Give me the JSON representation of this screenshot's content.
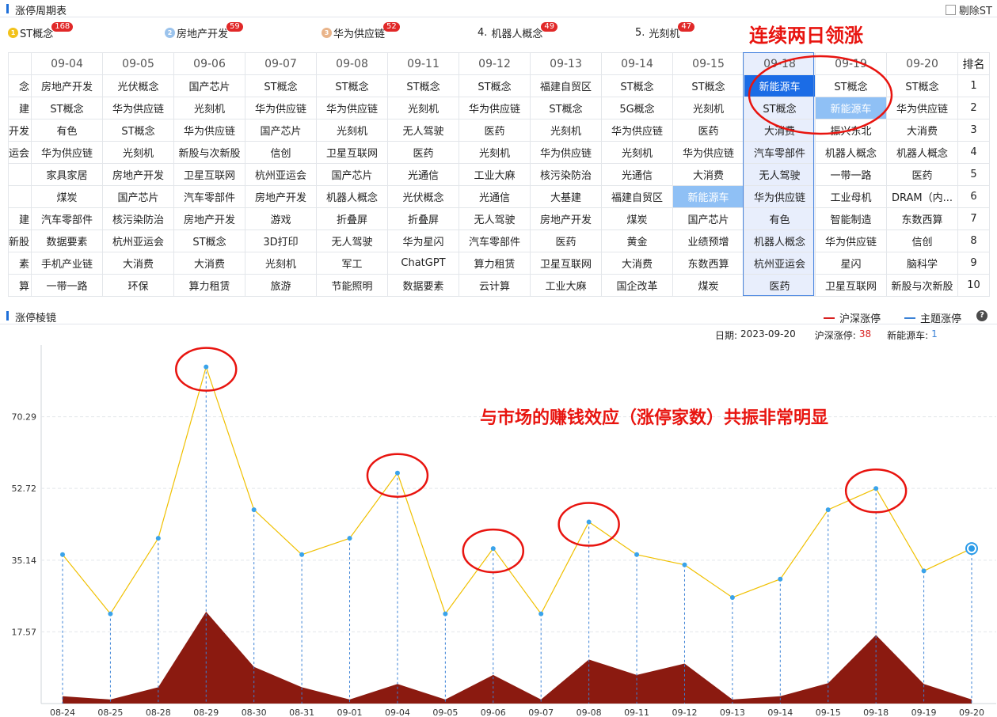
{
  "period_panel": {
    "title": "涨停周期表",
    "exclude_st_label": "剔除ST",
    "top_themes": [
      {
        "rank": "1",
        "label": "ST概念",
        "count": "168",
        "medal_color": "#f2c21a"
      },
      {
        "rank": "2",
        "label": "房地产开发",
        "count": "59",
        "medal_color": "#9bc3ec"
      },
      {
        "rank": "3",
        "label": "华为供应链",
        "count": "52",
        "medal_color": "#e9b48a"
      },
      {
        "rank": "4.",
        "label": "机器人概念",
        "count": "49"
      },
      {
        "rank": "5.",
        "label": "光刻机",
        "count": "47"
      }
    ],
    "annotation": "连续两日领涨",
    "columns": [
      "09-04",
      "09-05",
      "09-06",
      "09-07",
      "09-08",
      "09-11",
      "09-12",
      "09-13",
      "09-14",
      "09-15",
      "09-18",
      "09-19",
      "09-20"
    ],
    "rank_header": "排名",
    "stubs": [
      "念",
      "建",
      "开发",
      "运会",
      "",
      "",
      "建",
      "新股",
      "素",
      "算"
    ],
    "rows": [
      [
        "房地产开发",
        "光伏概念",
        "国产芯片",
        "ST概念",
        "ST概念",
        "ST概念",
        "ST概念",
        "福建自贸区",
        "ST概念",
        "ST概念",
        "新能源车",
        "ST概念",
        "ST概念"
      ],
      [
        "ST概念",
        "华为供应链",
        "光刻机",
        "华为供应链",
        "华为供应链",
        "光刻机",
        "华为供应链",
        "ST概念",
        "5G概念",
        "光刻机",
        "ST概念",
        "新能源车",
        "华为供应链"
      ],
      [
        "有色",
        "ST概念",
        "华为供应链",
        "国产芯片",
        "光刻机",
        "无人驾驶",
        "医药",
        "光刻机",
        "华为供应链",
        "医药",
        "大消费",
        "振兴东北",
        "大消费"
      ],
      [
        "华为供应链",
        "光刻机",
        "新股与次新股",
        "信创",
        "卫星互联网",
        "医药",
        "光刻机",
        "华为供应链",
        "光刻机",
        "华为供应链",
        "汽车零部件",
        "机器人概念",
        "机器人概念"
      ],
      [
        "家具家居",
        "房地产开发",
        "卫星互联网",
        "杭州亚运会",
        "国产芯片",
        "光通信",
        "工业大麻",
        "核污染防治",
        "光通信",
        "大消费",
        "无人驾驶",
        "一带一路",
        "医药"
      ],
      [
        "煤炭",
        "国产芯片",
        "汽车零部件",
        "房地产开发",
        "机器人概念",
        "光伏概念",
        "光通信",
        "大基建",
        "福建自贸区",
        "新能源车",
        "华为供应链",
        "工业母机",
        "DRAM（内..."
      ],
      [
        "汽车零部件",
        "核污染防治",
        "房地产开发",
        "游戏",
        "折叠屏",
        "折叠屏",
        "无人驾驶",
        "房地产开发",
        "煤炭",
        "国产芯片",
        "有色",
        "智能制造",
        "东数西算"
      ],
      [
        "数据要素",
        "杭州亚运会",
        "ST概念",
        "3D打印",
        "无人驾驶",
        "华为星闪",
        "汽车零部件",
        "医药",
        "黄金",
        "业绩预增",
        "机器人概念",
        "华为供应链",
        "信创"
      ],
      [
        "手机产业链",
        "大消费",
        "大消费",
        "光刻机",
        "军工",
        "ChatGPT",
        "算力租赁",
        "卫星互联网",
        "大消费",
        "东数西算",
        "杭州亚运会",
        "星闪",
        "脑科学"
      ],
      [
        "一带一路",
        "环保",
        "算力租赁",
        "旅游",
        "节能照明",
        "数据要素",
        "云计算",
        "工业大麻",
        "国企改革",
        "煤炭",
        "医药",
        "卫星互联网",
        "新股与次新股"
      ]
    ],
    "ranks": [
      "1",
      "2",
      "3",
      "4",
      "5",
      "6",
      "7",
      "8",
      "9",
      "10"
    ]
  },
  "prism_panel": {
    "title": "涨停棱镜",
    "legend": [
      {
        "label": "沪深涨停",
        "color": "#d82020"
      },
      {
        "label": "主题涨停",
        "color": "#3b82d6"
      }
    ],
    "info": {
      "date_label": "日期:",
      "date_value": "2023-09-20",
      "market_label": "沪深涨停:",
      "market_value": "38",
      "theme_label": "新能源车:",
      "theme_value": "1"
    },
    "annotation": "与市场的赚钱效应（涨停家数）共振非常明显"
  },
  "chart_data": {
    "type": "line",
    "x": [
      "08-24",
      "08-25",
      "08-28",
      "08-29",
      "08-30",
      "08-31",
      "09-01",
      "09-04",
      "09-05",
      "09-06",
      "09-07",
      "09-08",
      "09-11",
      "09-12",
      "09-13",
      "09-14",
      "09-15",
      "09-18",
      "09-19",
      "09-20"
    ],
    "y_ticks": [
      "17.57",
      "35.14",
      "52.72",
      "70.29"
    ],
    "ylim": [
      0,
      87.86
    ],
    "series": [
      {
        "name": "沪深涨停",
        "kind": "line",
        "color": "#f0c000",
        "values": [
          36.5,
          22,
          40.5,
          82.5,
          47.5,
          36.5,
          40.5,
          56.5,
          22,
          38,
          22,
          44.5,
          36.5,
          34,
          26,
          30.5,
          47.5,
          52.7,
          32.5,
          38
        ]
      },
      {
        "name": "主题涨停",
        "kind": "area",
        "color": "#8b1a10",
        "values": [
          1.8,
          1,
          4,
          22.5,
          9,
          4,
          1,
          4.8,
          1,
          7,
          1,
          10.8,
          7,
          9.8,
          1,
          1.8,
          5,
          16.8,
          4.8,
          1
        ]
      }
    ],
    "circled_x": [
      "08-29",
      "09-04",
      "09-06",
      "09-08",
      "09-18"
    ]
  }
}
